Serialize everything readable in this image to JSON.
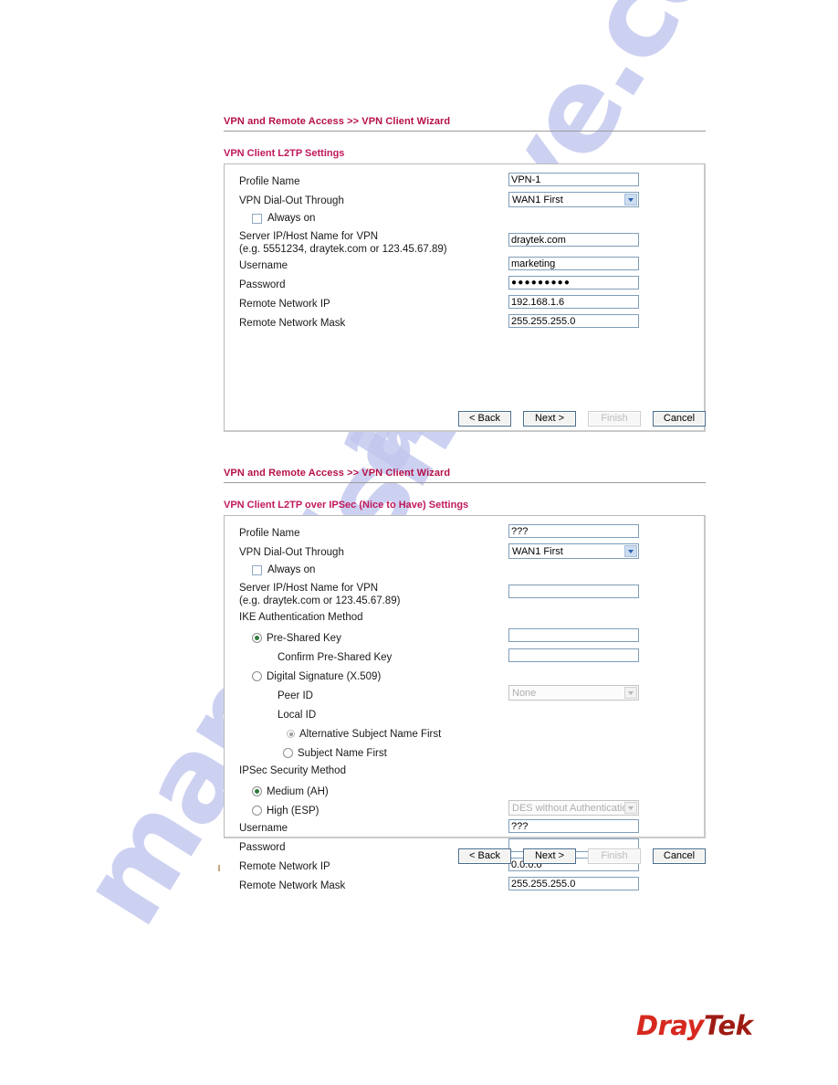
{
  "watermark": {
    "line_a": "archive.com",
    "line_b": "manualshi"
  },
  "logo": {
    "part1": "Dray",
    "part2": "Tek"
  },
  "buttons": {
    "back": "< Back",
    "next": "Next >",
    "finish": "Finish",
    "cancel": "Cancel"
  },
  "form_one": {
    "breadcrumb_main": "VPN and Remote Access",
    "breadcrumb_sep": ">>",
    "breadcrumb_sub": "VPN Client Wizard",
    "section_title": "VPN Client L2TP Settings",
    "labels": {
      "profile_name": "Profile Name",
      "dial_out": "VPN Dial-Out Through",
      "always_on": "Always on",
      "server_ip": "Server IP/Host Name for VPN",
      "server_ip_hint": "(e.g. 5551234, draytek.com or 123.45.67.89)",
      "username": "Username",
      "password": "Password",
      "remote_network_ip": "Remote Network IP",
      "remote_network_mask": "Remote Network Mask"
    },
    "values": {
      "profile_name": "VPN-1",
      "dial_out": "WAN1 First",
      "always_on_checked": false,
      "server_ip": "draytek.com",
      "username": "marketing",
      "password": "●●●●●●●●●",
      "remote_network_ip": "192.168.1.6",
      "remote_network_mask": "255.255.255.0"
    }
  },
  "form_two": {
    "breadcrumb_main": "VPN and Remote Access",
    "breadcrumb_sep": ">>",
    "breadcrumb_sub": "VPN Client Wizard",
    "section_title": "VPN Client L2TP over IPSec (Nice to Have) Settings",
    "labels": {
      "profile_name": "Profile Name",
      "dial_out": "VPN Dial-Out Through",
      "always_on": "Always on",
      "server_ip": "Server IP/Host Name for VPN",
      "server_ip_hint": "(e.g. draytek.com or 123.45.67.89)",
      "ike_auth_method": "IKE Authentication Method",
      "pre_shared_key": "Pre-Shared Key",
      "confirm_pre_shared_key": "Confirm Pre-Shared Key",
      "digital_signature": "Digital Signature (X.509)",
      "peer_id": "Peer ID",
      "local_id": "Local ID",
      "alt_subject_name_first": "Alternative Subject Name First",
      "subject_name_first": "Subject Name First",
      "ipsec_security_method": "IPSec Security Method",
      "medium_ah": "Medium (AH)",
      "high_esp": "High (ESP)",
      "username": "Username",
      "password": "Password",
      "remote_network_ip": "Remote Network IP",
      "remote_network_mask": "Remote Network Mask"
    },
    "values": {
      "profile_name": "???",
      "dial_out": "WAN1 First",
      "always_on_checked": false,
      "server_ip": "",
      "pre_shared_key": "",
      "confirm_pre_shared_key": "",
      "peer_id": "None",
      "esp_method": "DES without Authentication",
      "username": "???",
      "password": "",
      "remote_network_ip": "0.0.0.0",
      "remote_network_mask": "255.255.255.0"
    }
  }
}
